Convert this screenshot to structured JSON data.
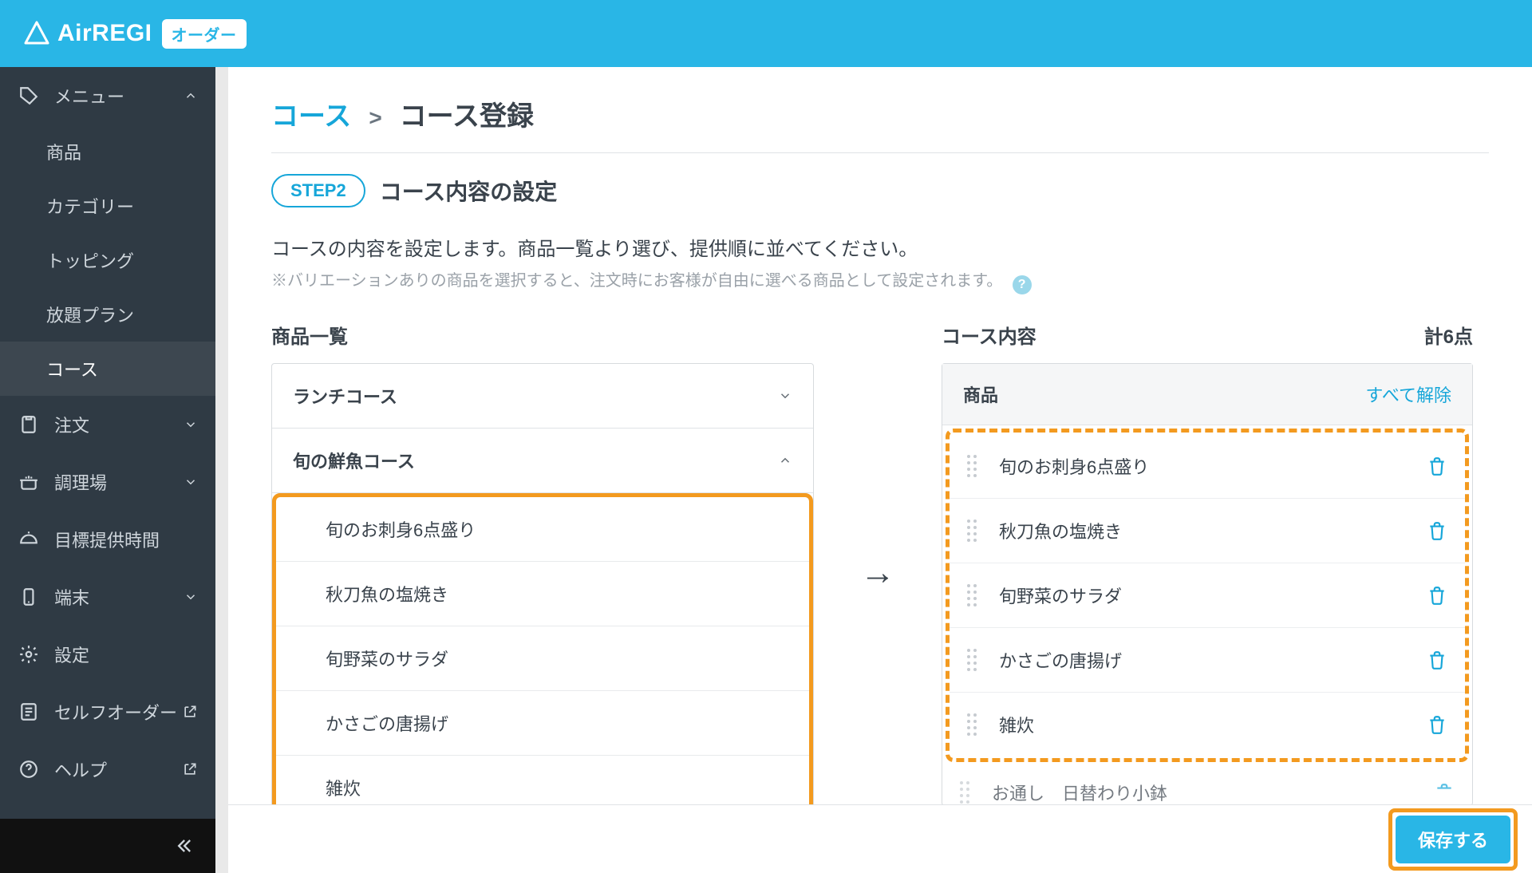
{
  "header": {
    "brand": "AirREGI",
    "badge": "オーダー"
  },
  "sidebar": {
    "menu_label": "メニュー",
    "subs": [
      "商品",
      "カテゴリー",
      "トッピング",
      "放題プラン",
      "コース"
    ],
    "active_sub_index": 4,
    "items": [
      {
        "label": "注文"
      },
      {
        "label": "調理場"
      },
      {
        "label": "目標提供時間"
      },
      {
        "label": "端末"
      },
      {
        "label": "設定"
      },
      {
        "label": "セルフオーダー"
      },
      {
        "label": "ヘルプ"
      }
    ]
  },
  "breadcrumb": {
    "parent": "コース",
    "sep": ">",
    "current": "コース登録"
  },
  "step": {
    "badge": "STEP2",
    "title": "コース内容の設定"
  },
  "description": {
    "line1": "コースの内容を設定します。商品一覧より選び、提供順に並べてください。",
    "line2": "※バリエーションありの商品を選択すると、注文時にお客様が自由に選べる商品として設定されます。"
  },
  "left": {
    "title": "商品一覧",
    "categories": [
      {
        "name": "ランチコース",
        "expanded": false,
        "items": []
      },
      {
        "name": "旬の鮮魚コース",
        "expanded": true,
        "items": [
          "旬のお刺身6点盛り",
          "秋刀魚の塩焼き",
          "旬野菜のサラダ",
          "かさごの唐揚げ",
          "雑炊"
        ]
      }
    ]
  },
  "arrow": "→",
  "right": {
    "title": "コース内容",
    "count_label": "計6点",
    "header_label": "商品",
    "clear_label": "すべて解除",
    "items": [
      "旬のお刺身6点盛り",
      "秋刀魚の塩焼き",
      "旬野菜のサラダ",
      "かさごの唐揚げ",
      "雑炊"
    ],
    "peek_item": "お通し　日替わり小鉢"
  },
  "footer": {
    "save_label": "保存する"
  }
}
